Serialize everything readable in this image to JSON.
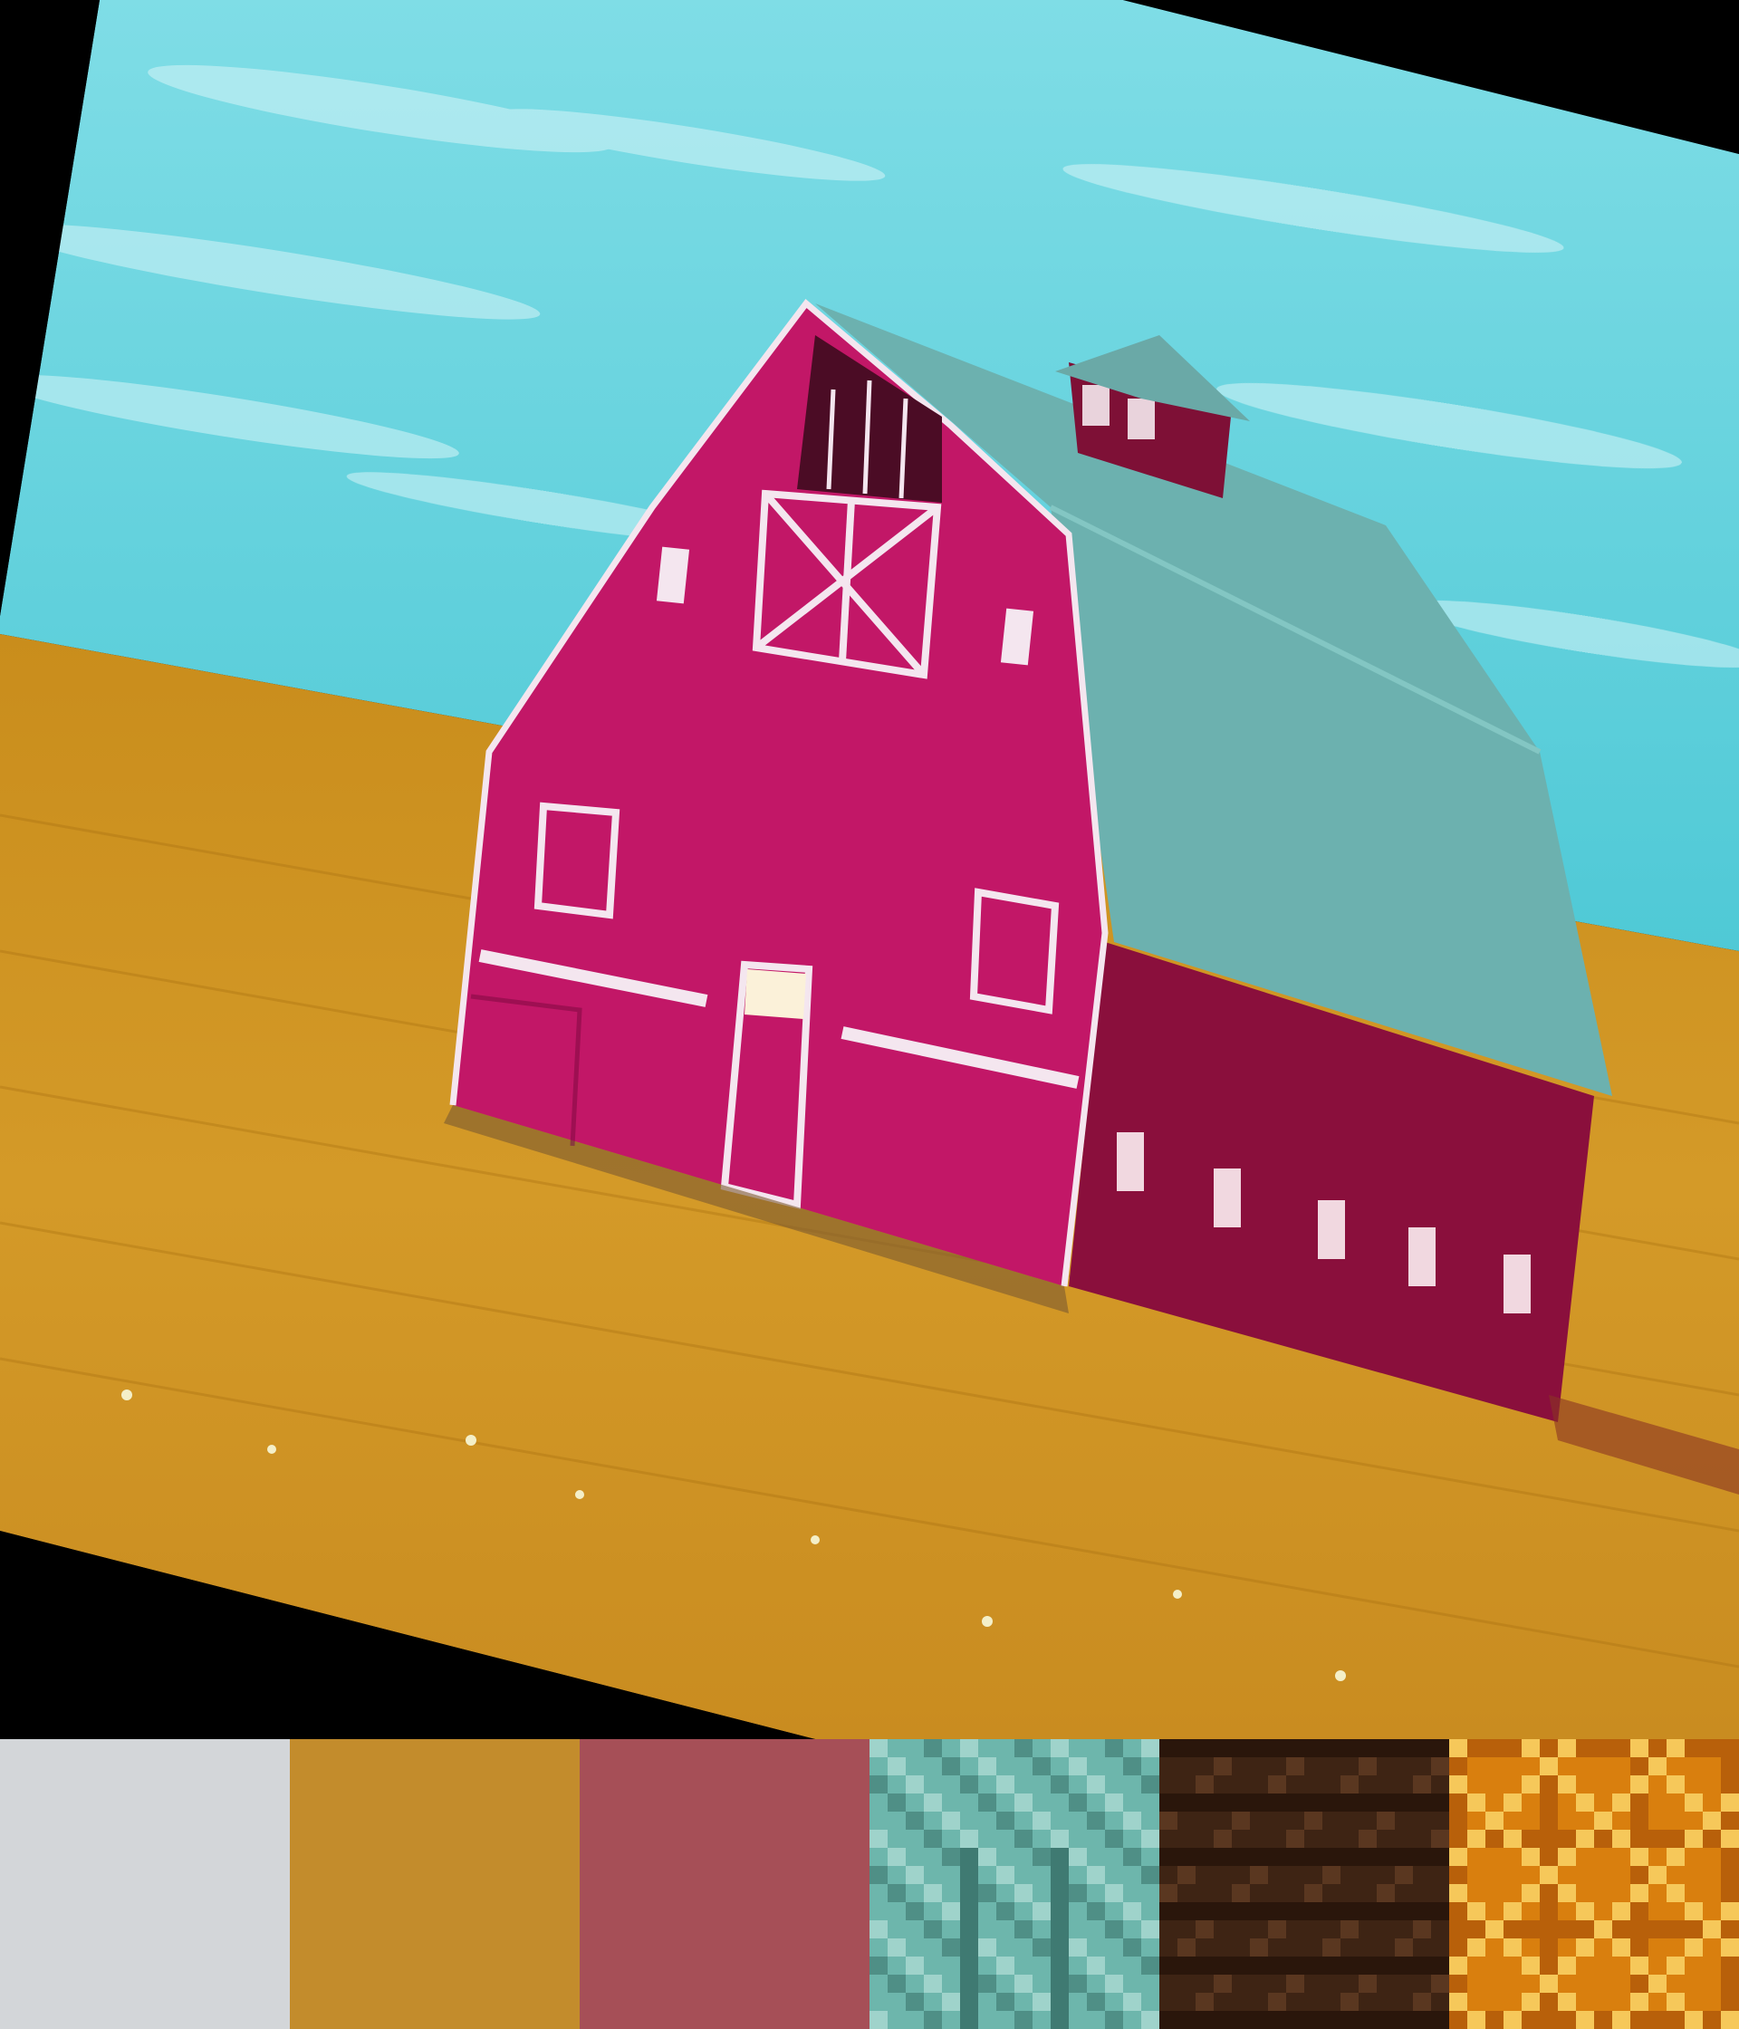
{
  "scene": {
    "subject": "barn",
    "colors": {
      "sky": "#5fd0dc",
      "sky_streak": "#c9f1f4",
      "field": "#cf9623",
      "field_dark": "#b57a14",
      "barn_front": "#c21767",
      "barn_side": "#8a0f3c",
      "roof": "#5fa5a4",
      "roof_side": "#6cb4b2",
      "trim": "#f4e6ef",
      "frame": "#000000"
    }
  },
  "palette": {
    "swatches": [
      {
        "name": "light-gray",
        "color": "#d3d6d9",
        "pattern": "solid"
      },
      {
        "name": "ochre",
        "color": "#c38c2c",
        "pattern": "solid"
      },
      {
        "name": "dusty-rose",
        "color": "#a64f57",
        "pattern": "solid"
      },
      {
        "name": "teal",
        "color": "#6db6ac",
        "pattern": "pixel-teal"
      },
      {
        "name": "dark-brown",
        "color": "#3e2414",
        "pattern": "pixel-brown"
      },
      {
        "name": "amber",
        "color": "#d97f0e",
        "pattern": "pixel-amber"
      }
    ]
  }
}
